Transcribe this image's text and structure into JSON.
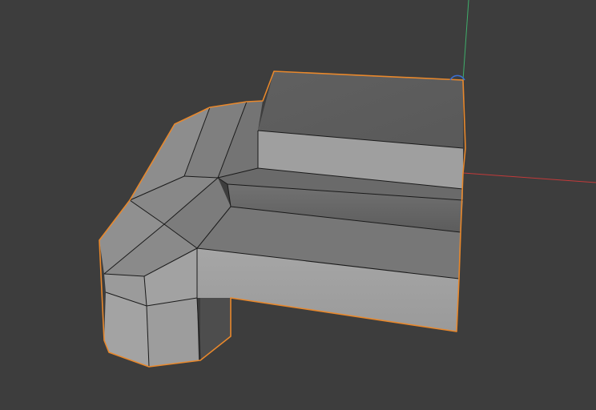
{
  "viewport": {
    "background": "#3d3d3d"
  },
  "colors": {
    "selection_outline": "#e8882c",
    "edge": "#1a1a1a",
    "axis_x": "#c23a3a",
    "axis_y": "#3fae6b",
    "origin_marker": "#3b6fd4",
    "face_front": "#a4a4a4",
    "face_top_dark": "#5d5d5d",
    "face_top_mid": "#6f6f6f",
    "face_side": "#8a8a8a",
    "face_shadow": "#4f4f4f"
  },
  "scene": {
    "object": "selected-mesh",
    "mode": "edit-wireframe-visible"
  }
}
